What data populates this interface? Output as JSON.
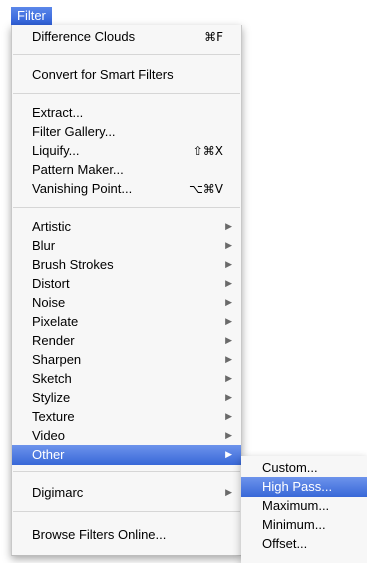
{
  "menubar": {
    "title": "Filter"
  },
  "menu": {
    "items": [
      {
        "label": "Difference Clouds",
        "shortcut": "⌘F"
      },
      {
        "label": "Convert for Smart Filters"
      },
      {
        "label": "Extract..."
      },
      {
        "label": "Filter Gallery..."
      },
      {
        "label": "Liquify...",
        "shortcut": "⇧⌘X"
      },
      {
        "label": "Pattern Maker..."
      },
      {
        "label": "Vanishing Point...",
        "shortcut": "⌥⌘V"
      },
      {
        "label": "Artistic"
      },
      {
        "label": "Blur"
      },
      {
        "label": "Brush Strokes"
      },
      {
        "label": "Distort"
      },
      {
        "label": "Noise"
      },
      {
        "label": "Pixelate"
      },
      {
        "label": "Render"
      },
      {
        "label": "Sharpen"
      },
      {
        "label": "Sketch"
      },
      {
        "label": "Stylize"
      },
      {
        "label": "Texture"
      },
      {
        "label": "Video"
      },
      {
        "label": "Other"
      },
      {
        "label": "Digimarc"
      },
      {
        "label": "Browse Filters Online..."
      }
    ],
    "submenu_arrow": "▶"
  },
  "submenu": {
    "items": [
      {
        "label": "Custom..."
      },
      {
        "label": "High Pass..."
      },
      {
        "label": "Maximum..."
      },
      {
        "label": "Minimum..."
      },
      {
        "label": "Offset..."
      }
    ]
  },
  "colors": {
    "selection": "#3868d8",
    "menu_background": "#f7f7f7"
  }
}
